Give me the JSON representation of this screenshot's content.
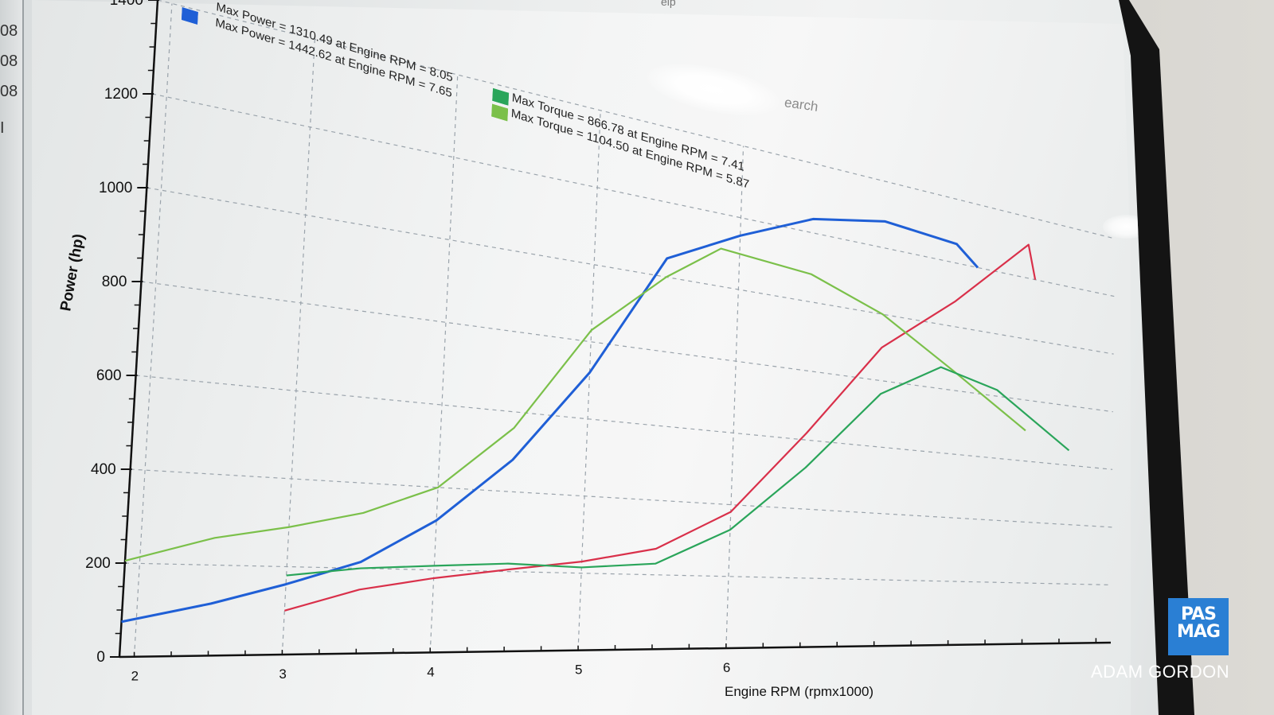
{
  "app": {
    "menu_help": "elp",
    "search_label": "earch"
  },
  "left_strip": {
    "partial_values": [
      "08",
      "08",
      "08",
      "I"
    ]
  },
  "legend": {
    "rows": [
      {
        "text": "Max Power = 1310.49 at Engine RPM = 8.05",
        "color": "#d9304a"
      },
      {
        "text": "Max Power = 1442.62 at Engine RPM = 7.65",
        "color": "#1f5fd6"
      },
      {
        "text": "Max Torque = 866.78 at Engine RPM = 7.41",
        "color": "#2aa55a"
      },
      {
        "text": "Max Torque = 1104.50 at Engine RPM = 5.87",
        "color": "#7bc04a"
      }
    ]
  },
  "chart_data": {
    "type": "line",
    "xlabel": "Engine RPM (rpmx1000)",
    "ylabel": "Power (hp)",
    "x_ticks": [
      "2",
      "3",
      "4",
      "5",
      "6"
    ],
    "y_ticks": [
      "0",
      "200",
      "400",
      "600",
      "800",
      "1000",
      "1200",
      "1400"
    ],
    "xlim": [
      1.9,
      8.6
    ],
    "ylim": [
      0,
      1400
    ],
    "grid": true,
    "series": [
      {
        "color": "#1f5fd6",
        "x": [
          1.9,
          2.5,
          3.0,
          3.5,
          4.0,
          4.5,
          5.0,
          5.5,
          6.0,
          6.5,
          7.0,
          7.5,
          7.65
        ],
        "values": [
          75,
          115,
          160,
          215,
          320,
          480,
          720,
          1050,
          1150,
          1240,
          1280,
          1260,
          1200
        ]
      },
      {
        "color": "#d9304a",
        "x": [
          3.0,
          3.5,
          4.0,
          4.5,
          5.0,
          5.5,
          6.0,
          6.5,
          7.0,
          7.5,
          8.0,
          8.05
        ],
        "values": [
          100,
          150,
          180,
          205,
          230,
          270,
          380,
          620,
          900,
          1080,
          1310,
          1200
        ]
      },
      {
        "color": "#7bc04a",
        "x": [
          1.9,
          2.5,
          3.0,
          3.5,
          4.0,
          4.5,
          5.0,
          5.5,
          5.87,
          6.5,
          7.0,
          7.5,
          8.0
        ],
        "values": [
          205,
          260,
          290,
          330,
          400,
          560,
          830,
          1000,
          1104,
          1080,
          1000,
          860,
          700
        ]
      },
      {
        "color": "#2aa55a",
        "x": [
          3.0,
          3.5,
          4.0,
          4.5,
          5.0,
          5.5,
          6.0,
          6.5,
          7.0,
          7.41,
          7.8,
          8.3
        ],
        "values": [
          180,
          200,
          210,
          220,
          215,
          230,
          330,
          520,
          760,
          867,
          820,
          650
        ]
      }
    ]
  },
  "watermark": {
    "logo_text": "PAS MAG",
    "credit": "ADAM GORDON"
  }
}
